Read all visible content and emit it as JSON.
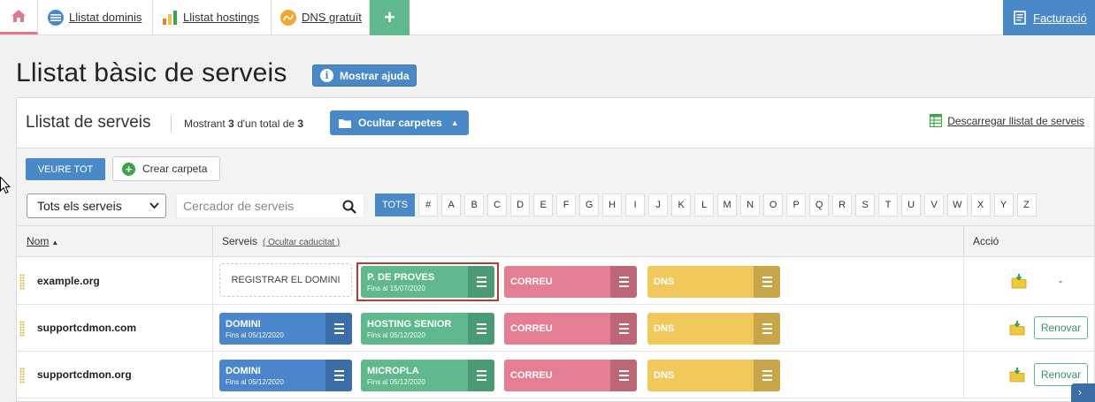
{
  "topnav": {
    "tabs": [
      {
        "label": "Llistat dominis",
        "icon": "domains-icon"
      },
      {
        "label": "Llistat hostings",
        "icon": "bar-chart-icon"
      },
      {
        "label": "DNS gratuït",
        "icon": "dns-icon"
      }
    ],
    "plus_label": "+",
    "billing_label": "Facturació"
  },
  "page": {
    "title": "Llistat bàsic de serveis",
    "help_label": "Mostrar ajuda"
  },
  "panel": {
    "title": "Llistat de serveis",
    "showing_prefix": "Mostrant",
    "showing_count": "3",
    "showing_mid": "d'un total de",
    "showing_total": "3",
    "folders_label": "Ocultar carpetes",
    "download_label": "Descarregar llistat de serveis"
  },
  "toolbar": {
    "view_all_label": "VEURE TOT",
    "create_folder_label": "Crear carpeta",
    "filter_value": "Tots els serveis",
    "search_placeholder": "Cercador de serveis",
    "letters": [
      "TOTS",
      "#",
      "A",
      "B",
      "C",
      "D",
      "E",
      "F",
      "G",
      "H",
      "I",
      "J",
      "K",
      "L",
      "M",
      "N",
      "O",
      "P",
      "Q",
      "R",
      "S",
      "T",
      "U",
      "V",
      "W",
      "X",
      "Y",
      "Z"
    ]
  },
  "table": {
    "col_name": "Nom",
    "col_services": "Serveis",
    "hide_expired": "( Ocultar caducitat )",
    "col_action": "Acció",
    "rows": [
      {
        "name": "example.org",
        "register_label": "REGISTRAR EL DOMINI",
        "services": [
          {
            "title": "P. DE PROVES",
            "sub": "Fins al 15/07/2020",
            "color": "#5fb98d"
          },
          {
            "title": "CORREU",
            "sub": "",
            "color": "#e47f93"
          },
          {
            "title": "DNS",
            "sub": "",
            "color": "#f0c85c"
          }
        ],
        "action_text": "-"
      },
      {
        "name": "supportcdmon.com",
        "services": [
          {
            "title": "DOMINI",
            "sub": "Fins al 05/12/2020",
            "color": "#4a86c9"
          },
          {
            "title": "HOSTING SENIOR",
            "sub": "Fins al 05/12/2020",
            "color": "#5fb98d"
          },
          {
            "title": "CORREU",
            "sub": "",
            "color": "#e47f93"
          },
          {
            "title": "DNS",
            "sub": "",
            "color": "#f0c85c"
          }
        ],
        "action_text": "Renovar"
      },
      {
        "name": "supportcdmon.org",
        "services": [
          {
            "title": "DOMINI",
            "sub": "Fins al 05/12/2020",
            "color": "#4a86c9"
          },
          {
            "title": "MICROPLA",
            "sub": "Fins al 05/12/2020",
            "color": "#5fb98d"
          },
          {
            "title": "CORREU",
            "sub": "",
            "color": "#e47f93"
          },
          {
            "title": "DNS",
            "sub": "",
            "color": "#f0c85c"
          }
        ],
        "action_text": "Renovar"
      }
    ]
  }
}
